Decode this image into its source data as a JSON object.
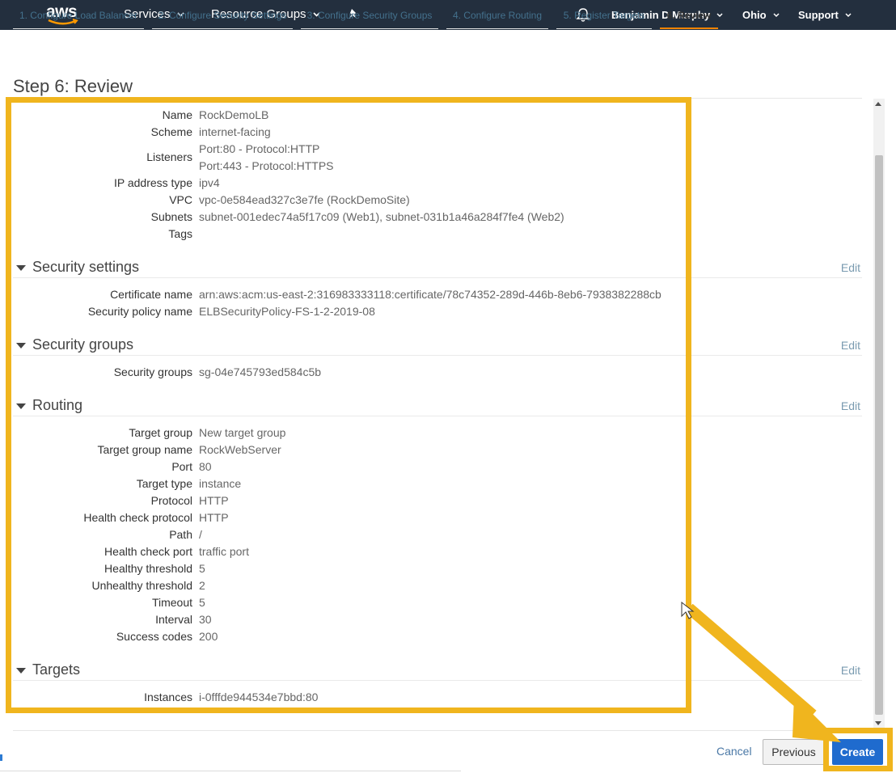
{
  "nav": {
    "logo_text": "aws",
    "services": "Services",
    "resource_groups": "Resource Groups",
    "user": "Benjamin D Murphy",
    "region": "Ohio",
    "support": "Support"
  },
  "tabs": [
    "1. Configure Load Balancer",
    "2. Configure Security Settings",
    "3. Configure Security Groups",
    "4. Configure Routing",
    "5. Register Targets",
    "6. Review"
  ],
  "step_title": "Step 6: Review",
  "basic": [
    {
      "label": "Name",
      "value": "RockDemoLB"
    },
    {
      "label": "Scheme",
      "value": "internet-facing"
    },
    {
      "label": "Listeners",
      "value": "Port:80 - Protocol:HTTP",
      "value2": "Port:443 - Protocol:HTTPS"
    },
    {
      "label": "IP address type",
      "value": "ipv4"
    },
    {
      "label": "VPC",
      "value": "vpc-0e584ead327c3e7fe (RockDemoSite)"
    },
    {
      "label": "Subnets",
      "value": "subnet-001edec74a5f17c09 (Web1), subnet-031b1a46a284f7fe4 (Web2)"
    },
    {
      "label": "Tags",
      "value": ""
    }
  ],
  "sections": {
    "security_settings": {
      "title": "Security settings",
      "edit": "Edit",
      "rows": [
        {
          "label": "Certificate name",
          "value": "arn:aws:acm:us-east-2:316983333118:certificate/78c74352-289d-446b-8eb6-7938382288cb"
        },
        {
          "label": "Security policy name",
          "value": "ELBSecurityPolicy-FS-1-2-2019-08"
        }
      ]
    },
    "security_groups": {
      "title": "Security groups",
      "edit": "Edit",
      "rows": [
        {
          "label": "Security groups",
          "value": "sg-04e745793ed584c5b"
        }
      ]
    },
    "routing": {
      "title": "Routing",
      "edit": "Edit",
      "rows": [
        {
          "label": "Target group",
          "value": "New target group"
        },
        {
          "label": "Target group name",
          "value": "RockWebServer"
        },
        {
          "label": "Port",
          "value": "80"
        },
        {
          "label": "Target type",
          "value": "instance"
        },
        {
          "label": "Protocol",
          "value": "HTTP"
        },
        {
          "label": "Health check protocol",
          "value": "HTTP"
        },
        {
          "label": "Path",
          "value": "/"
        },
        {
          "label": "Health check port",
          "value": "traffic port"
        },
        {
          "label": "Healthy threshold",
          "value": "5"
        },
        {
          "label": "Unhealthy threshold",
          "value": "2"
        },
        {
          "label": "Timeout",
          "value": "5"
        },
        {
          "label": "Interval",
          "value": "30"
        },
        {
          "label": "Success codes",
          "value": "200"
        }
      ]
    },
    "targets": {
      "title": "Targets",
      "edit": "Edit",
      "rows": [
        {
          "label": "Instances",
          "value": "i-0fffde944534e7bbd:80"
        }
      ]
    }
  },
  "footer": {
    "cancel": "Cancel",
    "previous": "Previous",
    "create": "Create"
  },
  "colors": {
    "nav_bg": "#232f3e",
    "highlight": "#f0b51e",
    "primary_button": "#1f6bce",
    "active_tab_underline": "#f08400"
  }
}
